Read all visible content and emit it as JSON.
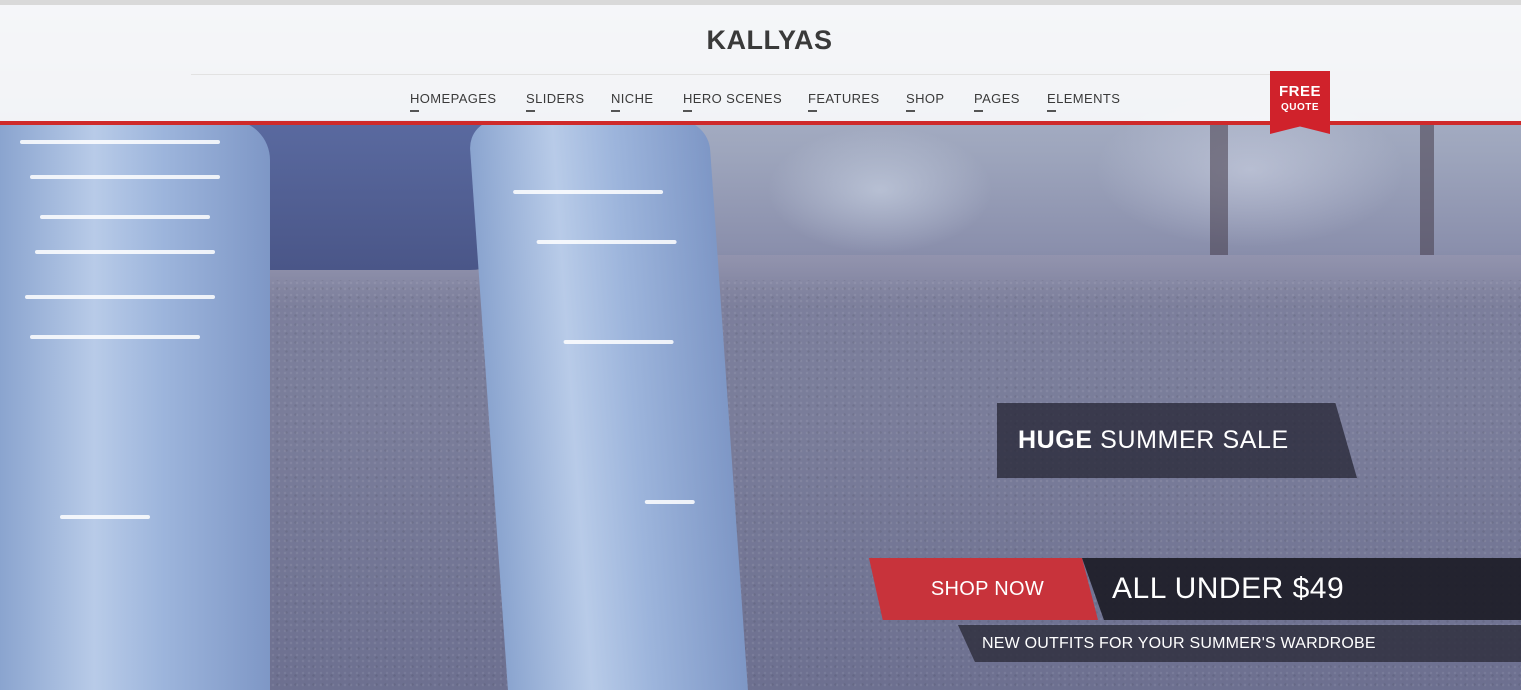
{
  "header": {
    "logo_text": "KALLYAS",
    "nav": [
      {
        "label": "HOMEPAGES"
      },
      {
        "label": "SLIDERS"
      },
      {
        "label": "NICHE"
      },
      {
        "label": "HERO SCENES"
      },
      {
        "label": "FEATURES"
      },
      {
        "label": "SHOP"
      },
      {
        "label": "PAGES"
      },
      {
        "label": "ELEMENTS"
      }
    ],
    "quote_button": {
      "line1": "FREE",
      "line2": "QUOTE"
    }
  },
  "hero": {
    "headline_bold": "HUGE",
    "headline_rest": " SUMMER SALE",
    "cta_label": "SHOP NOW",
    "price_text": "ALL UNDER $49",
    "subtext": "NEW OUTFITS FOR YOUR SUMMER'S WARDROBE"
  },
  "colors": {
    "accent_red": "#cf2a2a",
    "header_bg": "#ffffff",
    "caption_dark": "#1c1c26",
    "text_dark": "#3a3a3a"
  }
}
